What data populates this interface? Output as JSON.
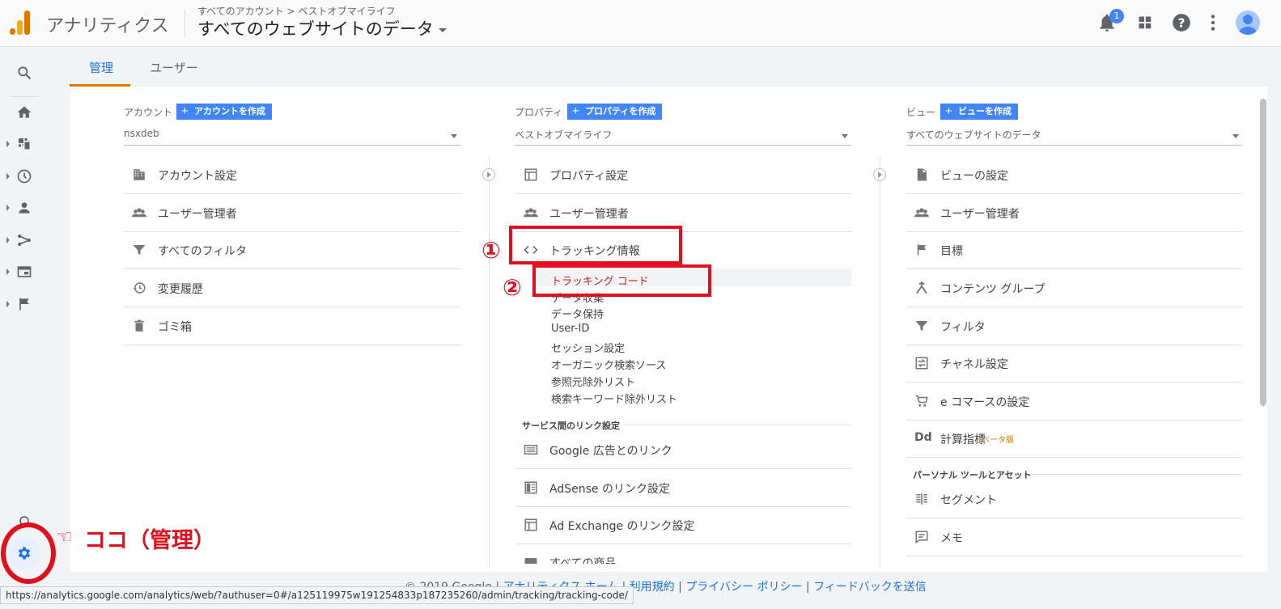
{
  "header": {
    "app_title": "アナリティクス",
    "breadcrumb": "すべてのアカウント > ベストオブマイライフ",
    "view_title": "すべてのウェブサイトのデータ",
    "notification_count": "1"
  },
  "tabs": {
    "admin": "管理",
    "user": "ユーザー"
  },
  "account": {
    "header": "アカウント",
    "create": "アカウントを作成",
    "selected": "nsxdeb",
    "items": [
      "アカウント設定",
      "ユーザー管理者",
      "すべてのフィルタ",
      "変更履歴",
      "ゴミ箱"
    ]
  },
  "property": {
    "header": "プロパティ",
    "create": "プロパティを作成",
    "selected": "ベストオブマイライフ",
    "items": [
      "プロパティ設定",
      "ユーザー管理者",
      "トラッキング情報"
    ],
    "tracking_sub": [
      "トラッキング コード",
      "データ収集",
      "データ保持",
      "User-ID",
      "セッション設定",
      "オーガニック検索ソース",
      "参照元除外リスト",
      "検索キーワード除外リスト"
    ],
    "link_section": "サービス間のリンク設定",
    "link_items": [
      "Google 広告とのリンク",
      "AdSense のリンク設定",
      "Ad Exchange のリンク設定",
      "すべての商品"
    ]
  },
  "view": {
    "header": "ビュー",
    "create": "ビューを作成",
    "selected": "すべてのウェブサイトのデータ",
    "items": [
      "ビューの設定",
      "ユーザー管理者",
      "目標",
      "コンテンツ グループ",
      "フィルタ",
      "チャネル設定",
      "e コマースの設定",
      "計算指標"
    ],
    "beta": "ベータ版",
    "personal_section": "パーソナル ツールとアセット",
    "personal_items": [
      "セグメント",
      "メモ"
    ]
  },
  "annotations": {
    "num1": "①",
    "num2": "②",
    "koko": "ココ（管理）",
    "hand": "☜"
  },
  "footer": {
    "copyright": "© 2019 Google",
    "links": [
      "アナリティクス ホーム",
      "利用規約",
      "プライバシー ポリシー",
      "フィードバックを送信"
    ]
  },
  "status_url": "https://analytics.google.com/analytics/web/?authuser=0#/a125119975w191254833p187235260/admin/tracking/tracking-code/",
  "colors": {
    "accent": "#1a73e8",
    "orange": "#e37400",
    "annotation_red": "#e0101e"
  }
}
